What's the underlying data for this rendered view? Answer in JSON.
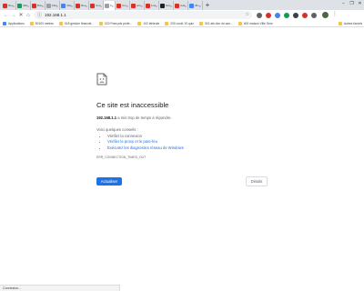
{
  "tabs": [
    {
      "label": "Nouv",
      "fav_color": "#d93025"
    },
    {
      "label": "Skills",
      "fav_color": "#0f9d58"
    },
    {
      "label": "Brevo",
      "fav_color": "#d93025"
    },
    {
      "label": "192.1",
      "fav_color": "#9aa0a6"
    },
    {
      "label": "Vidéo",
      "fav_color": "#4285f4"
    },
    {
      "label": "Recho",
      "fav_color": "#d93025"
    },
    {
      "label": "Cornu",
      "fav_color": "#d93025"
    },
    {
      "label": "19",
      "fav_color": "#9aa0a6",
      "active": true
    },
    {
      "label": "Conn",
      "fav_color": "#d93025"
    },
    {
      "label": "acces",
      "fav_color": "#d93025"
    },
    {
      "label": "Liste",
      "fav_color": "#d93025"
    },
    {
      "label": "How r",
      "fav_color": "#202124"
    },
    {
      "label": "Audio",
      "fav_color": "#d93025"
    },
    {
      "label": "36 au",
      "fav_color": "#4285f4"
    }
  ],
  "window_controls": {
    "minimize": "–",
    "maximize": "❐",
    "close": "✕"
  },
  "toolbar": {
    "url": "192.168.1.1",
    "extensions": [
      "#5f6368",
      "#d93025",
      "#4285f4",
      "#0f9d58",
      "#3c4043",
      "#d93025",
      "#5f6368"
    ]
  },
  "bookmarks": [
    {
      "label": "Applications",
      "icon": "apps-grid-icon"
    },
    {
      "label": "50100 metres",
      "icon": "folder-icon"
    },
    {
      "label": "018 gestion financiè...",
      "icon": "folder-icon"
    },
    {
      "label": "020 François profe...",
      "icon": "folder-icon"
    },
    {
      "label": "102 éthieule",
      "icon": "folder-icon"
    },
    {
      "label": "200 covid 19 quiz",
      "icon": "folder-icon"
    },
    {
      "label": "301 afs don du san...",
      "icon": "folder-icon"
    },
    {
      "label": "400 maison Ville Senr",
      "icon": "folder-icon"
    }
  ],
  "bookmarks_other": "Autres favoris",
  "error": {
    "title": "Ce site est inaccessible",
    "host": "192.168.1.1",
    "message": " a mis trop de temps à répondre.",
    "suggestions_head": "Voici quelques conseils :",
    "suggestions": [
      "Vérifier la connexion",
      "Vérifier le proxy et le pare-feu",
      "Exécutez les diagnostics réseau de Windows"
    ],
    "code": "ERR_CONNECTION_TIMED_OUT",
    "reload_label": "Actualiser",
    "details_label": "Détails"
  },
  "status": "Connexion..."
}
